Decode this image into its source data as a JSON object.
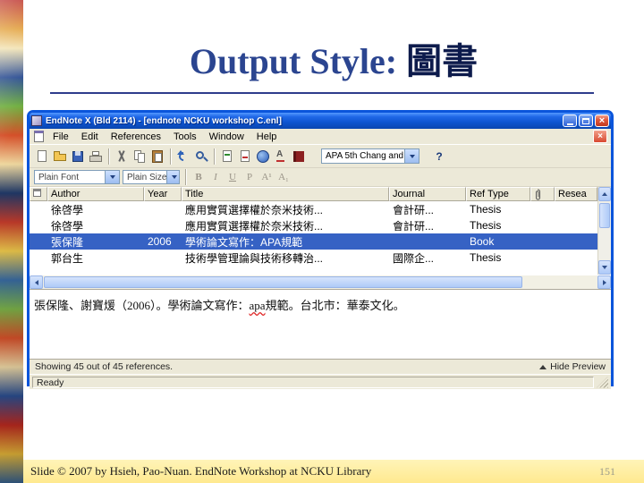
{
  "slide": {
    "title": {
      "prefix": "Output Style: ",
      "emphasis": "圖書"
    },
    "footer": {
      "credit": "Slide © 2007  by Hsieh, Pao-Nuan.  EndNote Workshop at NCKU Library",
      "page_number": "151"
    }
  },
  "window": {
    "title": "EndNote X (Bld 2114) - [endnote NCKU workshop C.enl]",
    "menus": [
      "File",
      "Edit",
      "References",
      "Tools",
      "Window",
      "Help"
    ],
    "toolbar": {
      "icons": [
        "new-reference",
        "open-library",
        "save",
        "print",
        "cut",
        "copy",
        "paste",
        "undo",
        "search",
        "insert-citation",
        "format-bibliography",
        "online-search",
        "spell-check",
        "open-link"
      ],
      "output_style": "APA 5th Chang and",
      "help": "?"
    },
    "format_toolbar": {
      "font": "Plain Font",
      "size": "Plain Size",
      "buttons": [
        "B",
        "I",
        "U",
        "P",
        "A¹",
        "A₁"
      ]
    },
    "table": {
      "headers": [
        {
          "label": ""
        },
        {
          "label": "Author"
        },
        {
          "label": "Year"
        },
        {
          "label": "Title"
        },
        {
          "label": "Journal"
        },
        {
          "label": "Ref Type"
        },
        {
          "label": ""
        },
        {
          "label": "Resea"
        }
      ],
      "rows": [
        {
          "author": "徐啓學",
          "year": "",
          "title": "應用實質選擇權於奈米技術...",
          "journal": "會計研...",
          "ref_type": "Thesis",
          "selected": false
        },
        {
          "author": "徐啓學",
          "year": "",
          "title": "應用實質選擇權於奈米技術...",
          "journal": "會計研...",
          "ref_type": "Thesis",
          "selected": false
        },
        {
          "author": "張保隆",
          "year": "2006",
          "title": "學術論文寫作：APA規範",
          "journal": "",
          "ref_type": "Book",
          "selected": true
        },
        {
          "author": "郭台生",
          "year": "",
          "title": "技術學管理論與技術移轉治...",
          "journal": "國際企...",
          "ref_type": "Thesis",
          "selected": false
        }
      ]
    },
    "preview": {
      "before": "張保隆、謝寶煖（2006）。學術論文寫作：",
      "highlight": "apa",
      "after": "規範。台北市：華泰文化。"
    },
    "status": {
      "showing": "Showing 45 out of 45 references.",
      "hide_preview": "Hide Preview",
      "ready": "Ready"
    }
  }
}
